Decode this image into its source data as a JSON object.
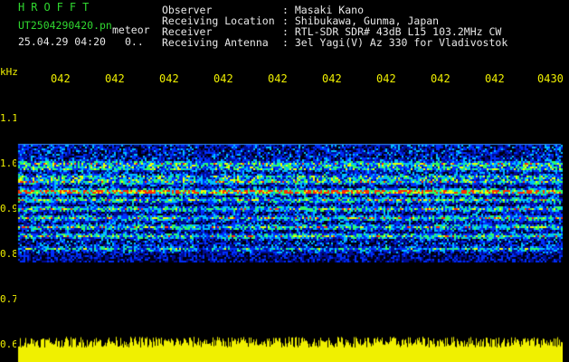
{
  "header": {
    "title": "HROFFT",
    "filename": "UT2504290420.pn",
    "detection_type": "meteor",
    "datetime": "25.04.29 04:20",
    "count": "0..",
    "fields": [
      {
        "label": "Observer",
        "value": ": Masaki Kano"
      },
      {
        "label": "Receiving Location",
        "value": ": Shibukawa, Gunma, Japan"
      },
      {
        "label": "Receiver",
        "value": ": RTL-SDR SDR# 43dB L15 103.2MHz CW"
      },
      {
        "label": "Receiving Antenna",
        "value": ": 3el Yagi(V) Az 330 for Vladivostok"
      }
    ]
  },
  "axes": {
    "y_unit": "kHz",
    "y_ticks": [
      "1.1",
      "1.0",
      "0.9",
      "0.8",
      "0.7",
      "0.6"
    ],
    "x_ticks": [
      "042",
      "042",
      "042",
      "042",
      "042",
      "042",
      "042",
      "042",
      "042",
      "0430"
    ]
  },
  "colors": {
    "text_green": "#30d830",
    "text_white": "#e8e8e8",
    "axis_yellow": "#f0f000",
    "background": "#000000"
  }
}
